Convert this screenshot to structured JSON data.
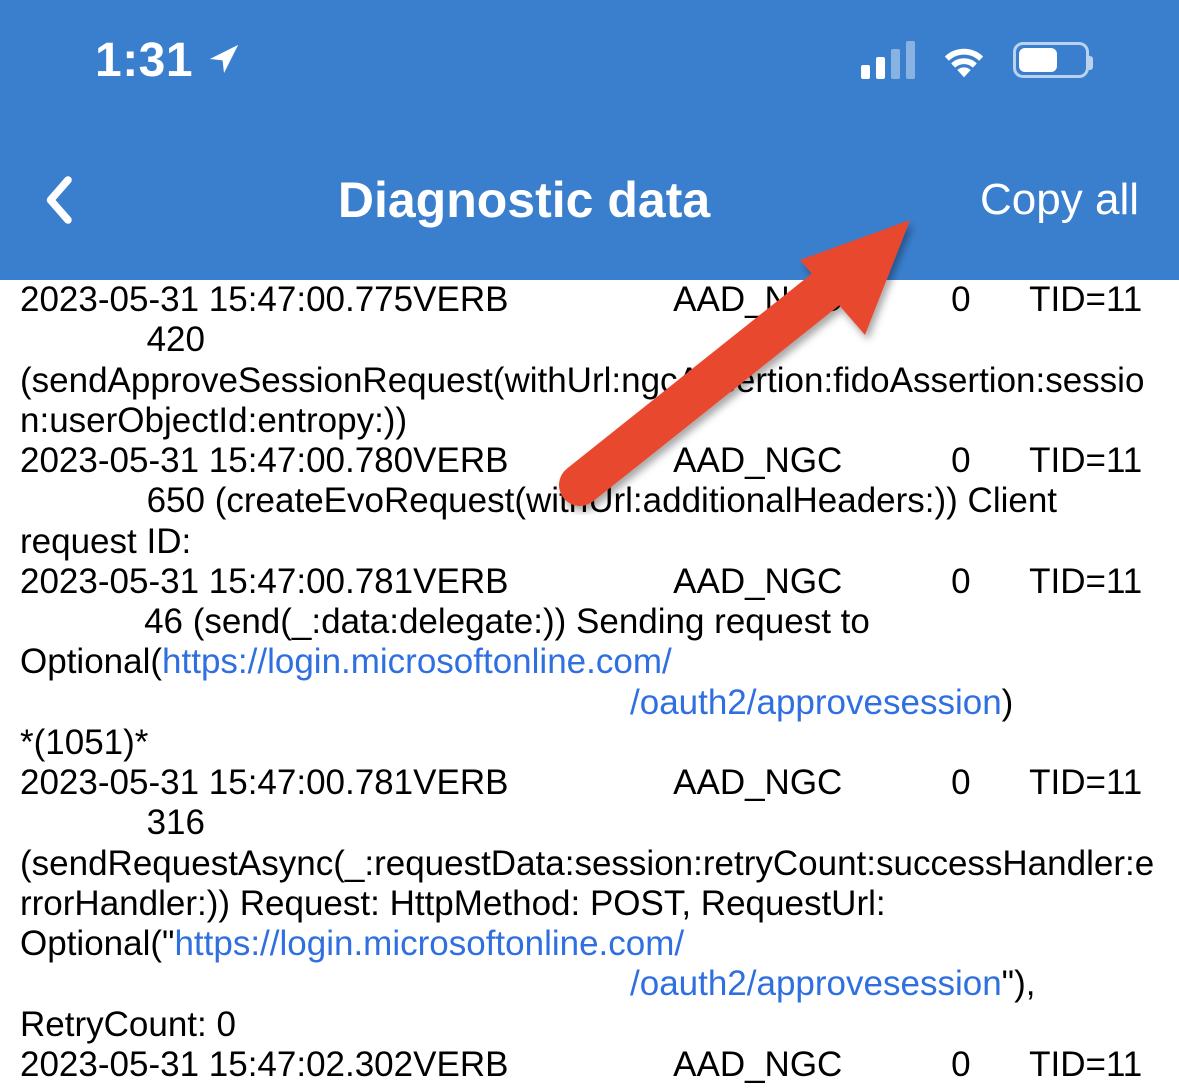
{
  "status": {
    "time": "1:31",
    "location_active": true
  },
  "header": {
    "title": "Diagnostic data",
    "copy_label": "Copy all"
  },
  "logs": [
    {
      "ts": "2023-05-31 15:47:00.775",
      "level": "VERB",
      "category": "AAD_NGC",
      "zero": "0",
      "tid": "TID=11",
      "msg_num": "420",
      "msg_text": "(sendApproveSessionRequest(withUrl:ngcAssertion:fidoAssertion:session:userObjectId:entropy:))"
    },
    {
      "ts": "2023-05-31 15:47:00.780",
      "level": "VERB",
      "category": "AAD_NGC",
      "zero": "0",
      "tid": "TID=11",
      "msg_num": "650",
      "msg_text": " (createEvoRequest(withUrl:additionalHeaders:)) Client request ID:"
    },
    {
      "ts": "2023-05-31 15:47:00.781",
      "level": "VERB",
      "category": "AAD_NGC",
      "zero": "0",
      "tid": "TID=11",
      "msg_num": "46",
      "msg_text_a": " (send(_:data:delegate:)) Sending request to Optional(",
      "link1": "https://login.microsoftonline.com/",
      "link2": "/oauth2/approvesession",
      "msg_text_b": ")",
      "extra": "*(1051)*"
    },
    {
      "ts": "2023-05-31 15:47:00.781",
      "level": "VERB",
      "category": "AAD_NGC",
      "zero": "0",
      "tid": "TID=11",
      "msg_num": "316",
      "msg_text_a": "(sendRequestAsync(_:requestData:session:retryCount:successHandler:errorHandler:)) Request: HttpMethod: POST, RequestUrl: Optional(\"",
      "link1": "https://login.microsoftonline.com/",
      "link2": "/oauth2/approvesession",
      "msg_text_b": "\"), RetryCount: 0"
    },
    {
      "ts": "2023-05-31 15:47:02.302",
      "level": "VERB",
      "category": "AAD_NGC",
      "zero": "0",
      "tid": "TID=11"
    }
  ]
}
